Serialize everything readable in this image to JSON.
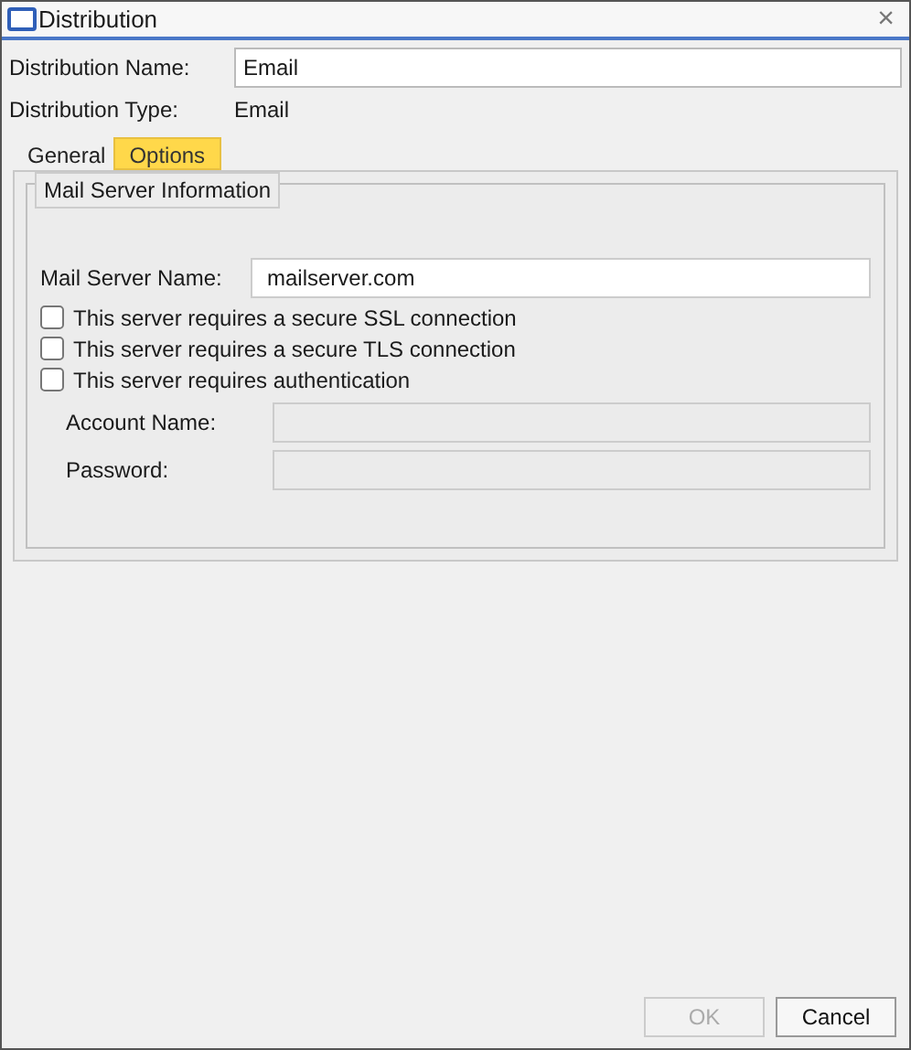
{
  "window": {
    "title": "Distribution",
    "close": "×"
  },
  "fields": [
    {
      "label": "Distribution Name:",
      "value": "Email"
    }
  ],
  "info": [
    {
      "label": "Distribution Type:",
      "value": "Email"
    }
  ],
  "tabs": [
    {
      "label": "General",
      "selected": false
    },
    {
      "label": "Options",
      "selected": true
    }
  ],
  "group": {
    "title": "Mail Server Information",
    "server": {
      "label": "Mail Server Name:",
      "value": "mailserver.com"
    },
    "checkboxes": [
      {
        "label": "This server requires a secure SSL connection",
        "checked": false
      },
      {
        "label": "This server requires a secure TLS connection",
        "checked": false
      },
      {
        "label": "This server requires authentication",
        "checked": false
      }
    ],
    "credentials": [
      {
        "label": "Account Name:",
        "disabled": true
      },
      {
        "label": "Password:",
        "disabled": true
      }
    ]
  },
  "buttons": [
    {
      "label": "OK",
      "disabled": true
    },
    {
      "label": "Cancel",
      "disabled": false
    }
  ]
}
